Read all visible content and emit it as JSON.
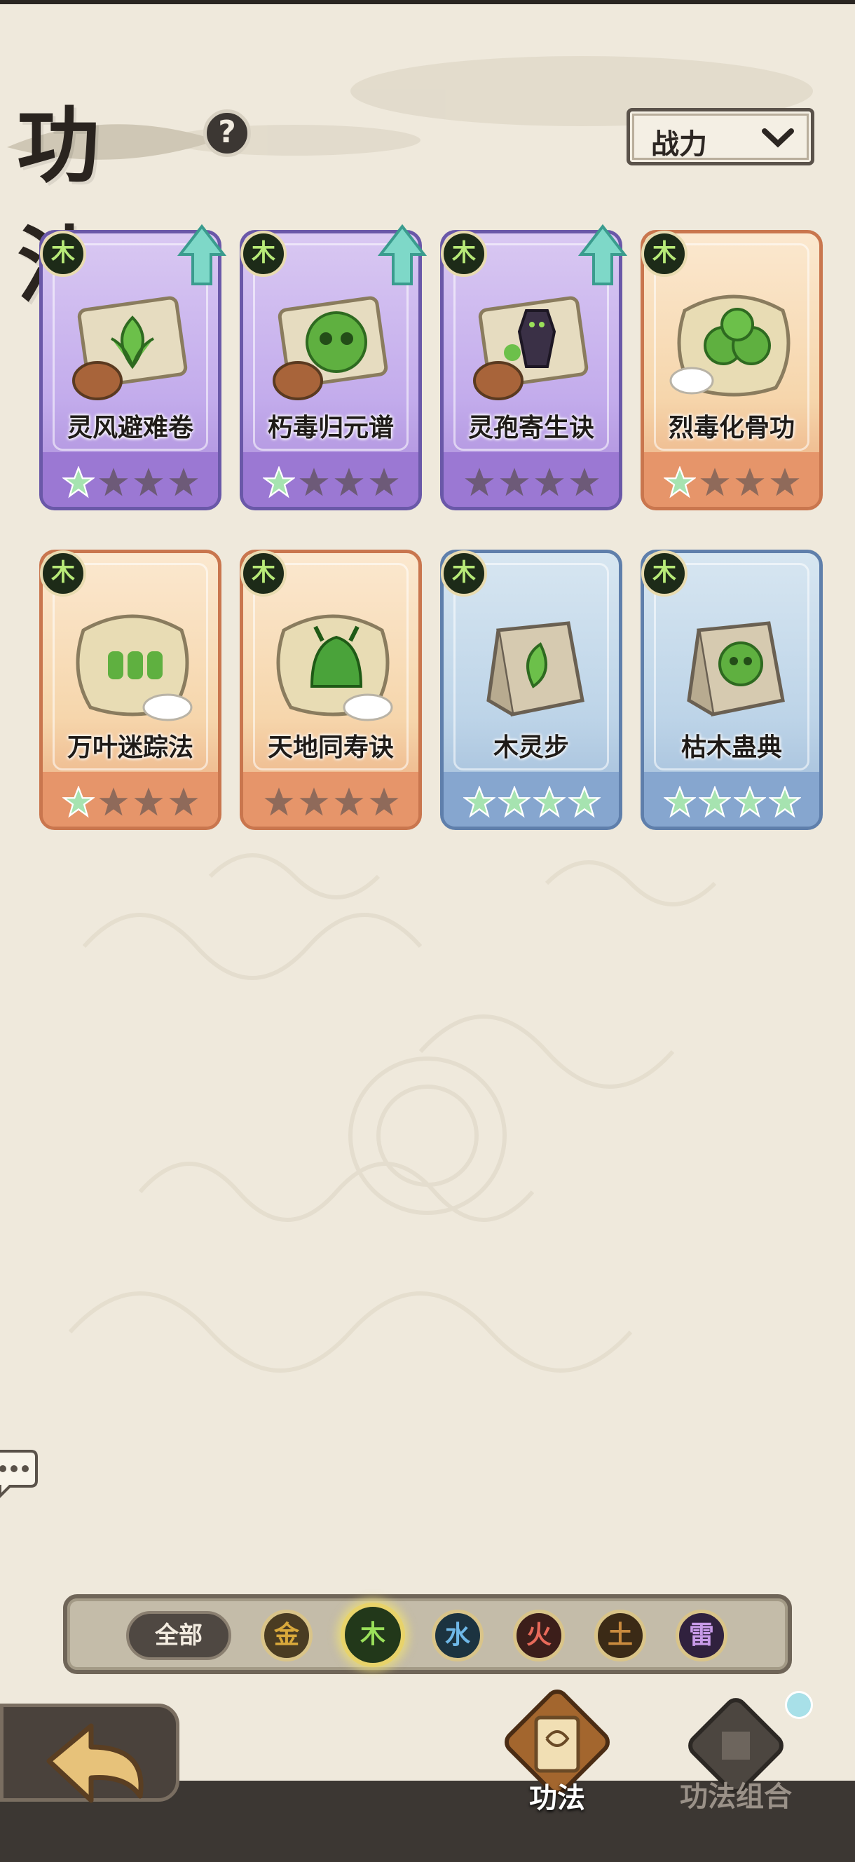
{
  "page": {
    "title": "功法",
    "help_label": "?"
  },
  "sort": {
    "label": "战力"
  },
  "cards": [
    {
      "name": "灵风避难卷",
      "element": "木",
      "rarity": "purple",
      "upgrade": true,
      "stars_lit": 1,
      "art": "green-leaf-scroll"
    },
    {
      "name": "朽毒归元谱",
      "element": "木",
      "rarity": "purple",
      "upgrade": true,
      "stars_lit": 1,
      "art": "poison-skull-scroll"
    },
    {
      "name": "灵孢寄生诀",
      "element": "木",
      "rarity": "purple",
      "upgrade": true,
      "stars_lit": 0,
      "art": "shadow-figure-scroll"
    },
    {
      "name": "烈毒化骨功",
      "element": "木",
      "rarity": "orange",
      "upgrade": false,
      "stars_lit": 1,
      "art": "poison-cloud-dragon"
    },
    {
      "name": "万叶迷踪法",
      "element": "木",
      "rarity": "orange",
      "upgrade": false,
      "stars_lit": 1,
      "art": "leaf-figures-dragon"
    },
    {
      "name": "天地同寿诀",
      "element": "木",
      "rarity": "orange",
      "upgrade": false,
      "stars_lit": 0,
      "art": "green-beast-dragon"
    },
    {
      "name": "木灵步",
      "element": "木",
      "rarity": "blue",
      "upgrade": false,
      "stars_lit": 4,
      "art": "leaf-book"
    },
    {
      "name": "枯木蛊典",
      "element": "木",
      "rarity": "blue",
      "upgrade": false,
      "stars_lit": 4,
      "art": "skull-book"
    }
  ],
  "filter": {
    "all_label": "全部",
    "elements": [
      {
        "label": "金",
        "color": "#d9a93b",
        "selected": false
      },
      {
        "label": "木",
        "color": "#9ae05a",
        "selected": true
      },
      {
        "label": "水",
        "color": "#6fb8e8",
        "selected": false
      },
      {
        "label": "火",
        "color": "#e86a5a",
        "selected": false
      },
      {
        "label": "土",
        "color": "#c98a3e",
        "selected": false
      },
      {
        "label": "雷",
        "color": "#c89ae8",
        "selected": false
      }
    ]
  },
  "tabs": {
    "gongfa": "功法",
    "combo": "功法组合"
  },
  "colors": {
    "wood_green": "#b7ea78",
    "star_lit": "#a6e3b0",
    "star_dim": "#6d5a78"
  }
}
